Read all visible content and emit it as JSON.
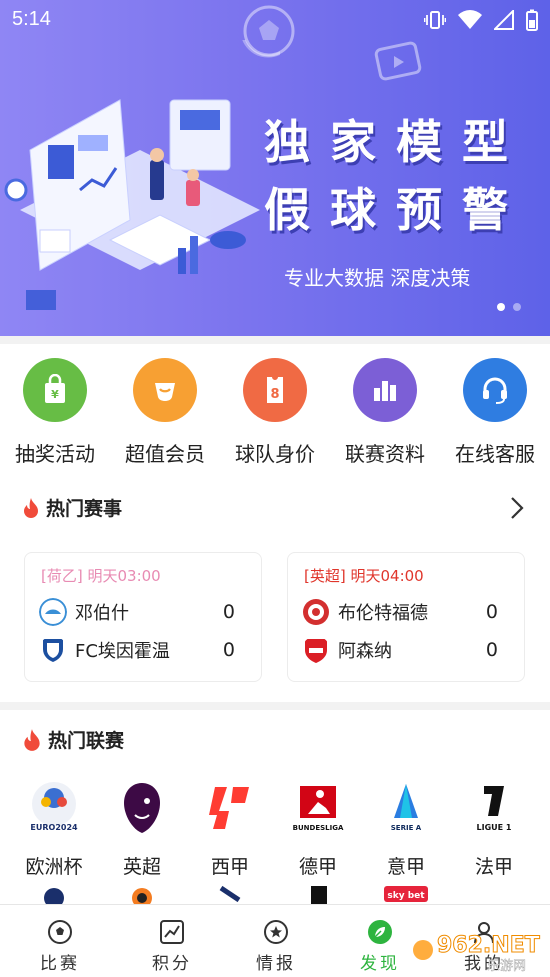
{
  "status_bar": {
    "time": "5:14"
  },
  "banner": {
    "title_line1": "独家模型",
    "title_line2": "假球预警",
    "subtitle": "专业大数据 深度决策",
    "slides": 2,
    "active_slide": 1
  },
  "menu": {
    "items": [
      {
        "label": "抽奖活动",
        "icon": "gift-bag-icon",
        "color": "#67bd45"
      },
      {
        "label": "超值会员",
        "icon": "diamond-icon",
        "color": "#f7a033"
      },
      {
        "label": "球队身价",
        "icon": "jersey-icon",
        "color": "#f06a44"
      },
      {
        "label": "联赛资料",
        "icon": "bar-stats-icon",
        "color": "#7c5fd6"
      },
      {
        "label": "在线客服",
        "icon": "headset-icon",
        "color": "#2f7de1"
      }
    ]
  },
  "hot_matches": {
    "title": "热门赛事",
    "matches": [
      {
        "league": "[荷乙]",
        "time": "明天03:00",
        "meta_color": "#e88bb3",
        "home": {
          "name": "邓伯什",
          "score": "0"
        },
        "away": {
          "name": "FC埃因霍温",
          "score": "0"
        }
      },
      {
        "league": "[英超]",
        "time": "明天04:00",
        "meta_color": "#e0362c",
        "home": {
          "name": "布伦特福德",
          "score": "0"
        },
        "away": {
          "name": "阿森纳",
          "score": "0"
        }
      }
    ]
  },
  "hot_leagues": {
    "title": "热门联赛",
    "leagues": [
      {
        "name": "欧洲杯",
        "logo_text": "EURO2024"
      },
      {
        "name": "英超",
        "logo_text": ""
      },
      {
        "name": "西甲",
        "logo_text": ""
      },
      {
        "name": "德甲",
        "logo_text": "BUNDESLIGA"
      },
      {
        "name": "意甲",
        "logo_text": "SERIE A"
      },
      {
        "name": "法甲",
        "logo_text": "LIGUE 1"
      }
    ],
    "partial_logo_text": "sky bet"
  },
  "tabbar": {
    "tabs": [
      {
        "label": "比赛",
        "icon": "soccer-ball-icon"
      },
      {
        "label": "积分",
        "icon": "chart-line-icon"
      },
      {
        "label": "情报",
        "icon": "star-circle-icon"
      },
      {
        "label": "发现",
        "icon": "compass-leaf-icon",
        "active": true
      },
      {
        "label": "我的",
        "icon": "person-icon"
      }
    ]
  },
  "watermark": {
    "text": "962.NET",
    "subtext": "乐游网"
  },
  "colors": {
    "active_tab": "#2eb43f",
    "fire": "#f04b3a",
    "banner_start": "#8f86f4",
    "banner_end": "#5e62e8"
  }
}
